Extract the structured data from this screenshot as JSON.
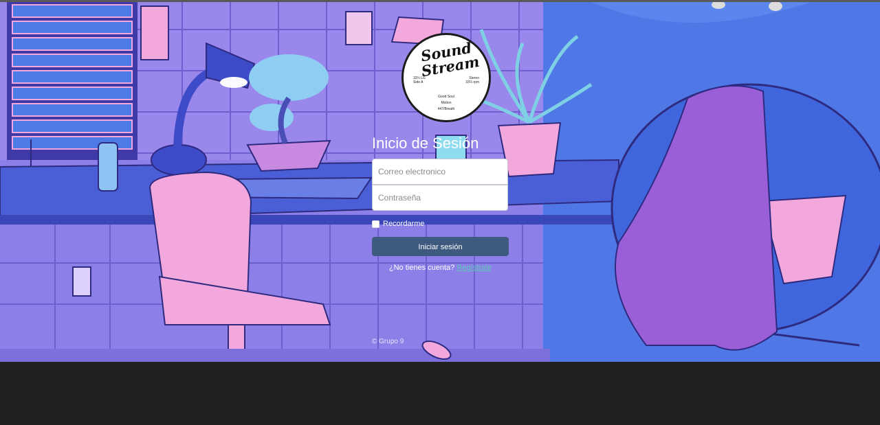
{
  "logo": {
    "line1": "Sound",
    "line2": "Stream",
    "left_text": "33⅓ LG\nSide A",
    "right_text": "Stereo\n33⅓ rpm",
    "center_text": "Good Soul\nMotion\n447/Breath"
  },
  "form": {
    "title": "Inicio de Sesión",
    "email_placeholder": "Correo electronico",
    "password_placeholder": "Contraseña",
    "remember_label": "Recordarme",
    "submit_label": "Iniciar sesión",
    "signup_prompt": "¿No tienes cuenta?",
    "signup_link": "Regístrate"
  },
  "footer": {
    "text": "© Grupo 9"
  },
  "colors": {
    "wall": "#8b7ee6",
    "window_blind": "#4c6fe0",
    "desk": "#4a5fd6",
    "chair_pink": "#f2a8dc",
    "button": "#3e5a7e",
    "link": "#5ec8b8",
    "page_background": "#212121"
  }
}
